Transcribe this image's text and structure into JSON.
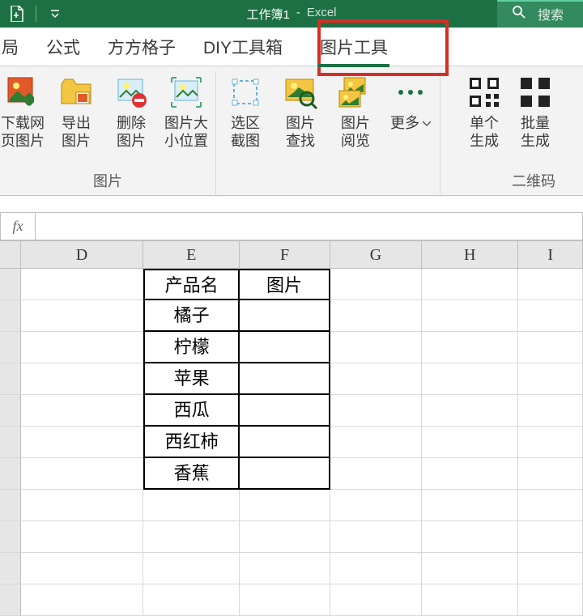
{
  "title": {
    "workbook": "工作簿1",
    "sep": "-",
    "app": "Excel"
  },
  "search": {
    "label": "搜索"
  },
  "tabs": {
    "t0": "局",
    "t1": "公式",
    "t2": "方方格子",
    "t3": "DIY工具箱",
    "t4": "图片工具"
  },
  "ribbon": {
    "g1": {
      "b1l1": "下载网",
      "b1l2": "页图片",
      "b2l1": "导出",
      "b2l2": "图片",
      "b3l1": "删除",
      "b3l2": "图片",
      "b4l1": "图片大",
      "b4l2": "小位置",
      "label": "图片"
    },
    "g2": {
      "b1l1": "选区",
      "b1l2": "截图",
      "b2l1": "图片",
      "b2l2": "查找",
      "b3l1": "图片",
      "b3l2": "阅览",
      "b4": "更多"
    },
    "g3": {
      "b1l1": "单个",
      "b1l2": "生成",
      "b2l1": "批量",
      "b2l2": "生成",
      "label": "二维码"
    }
  },
  "formula": {
    "fx": "fx",
    "value": ""
  },
  "columns": {
    "D": "D",
    "E": "E",
    "F": "F",
    "G": "G",
    "H": "H",
    "I": "I"
  },
  "table": {
    "header_product": "产品名",
    "header_image": "图片",
    "r1": "橘子",
    "r2": "柠檬",
    "r3": "苹果",
    "r4": "西瓜",
    "r5": "西红柿",
    "r6": "香蕉"
  }
}
